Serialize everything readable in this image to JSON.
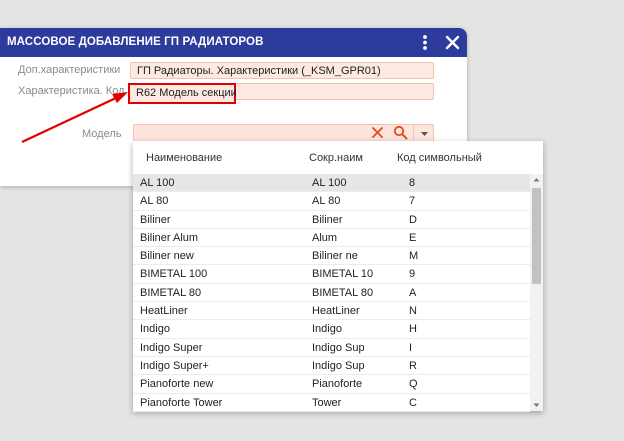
{
  "dialog": {
    "title": "МАССОВОЕ ДОБАВЛЕНИЕ ГП РАДИАТОРОВ",
    "fields": {
      "dop_label": "Доп.характеристики",
      "dop_value": "ГП Радиаторы. Характеристики (_KSM_GPR01)",
      "code_label": "Характеристика. Код",
      "code_value": "R62 Модель секции",
      "model_label": "Модель",
      "model_value": ""
    }
  },
  "dropdown": {
    "columns": [
      "Наименование",
      "Сокр.наим",
      "Код символьный"
    ],
    "selected_index": 0,
    "rows": [
      [
        "AL 100",
        "AL 100",
        "8"
      ],
      [
        "AL 80",
        "AL 80",
        "7"
      ],
      [
        "Biliner",
        "Biliner",
        "D"
      ],
      [
        "Biliner Alum",
        "Alum",
        "E"
      ],
      [
        "Biliner new",
        "Biliner ne",
        "M"
      ],
      [
        "BIMETAL 100",
        "BIMETAL 10",
        "9"
      ],
      [
        "BIMETAL 80",
        "BIMETAL 80",
        "A"
      ],
      [
        "HeatLiner",
        "HeatLiner",
        "N"
      ],
      [
        "Indigo",
        "Indigo",
        "H"
      ],
      [
        "Indigo Super",
        "Indigo Sup",
        "I"
      ],
      [
        "Indigo Super+",
        "Indigo Sup",
        "R"
      ],
      [
        "Pianoforte new",
        "Pianoforte",
        "Q"
      ],
      [
        "Pianoforte Tower",
        "Tower",
        "C"
      ]
    ]
  },
  "colors": {
    "titlebar": "#2d3b9c",
    "field_bg": "#fde8e2",
    "highlight": "#e00000",
    "accent_icon": "#e64a19"
  },
  "icons": {
    "menu": "vertical-dots-icon",
    "close": "close-icon",
    "clear": "clear-x-icon",
    "search": "search-icon",
    "dropdown": "chevron-down-icon",
    "annotation": "red-arrow-annotation"
  }
}
